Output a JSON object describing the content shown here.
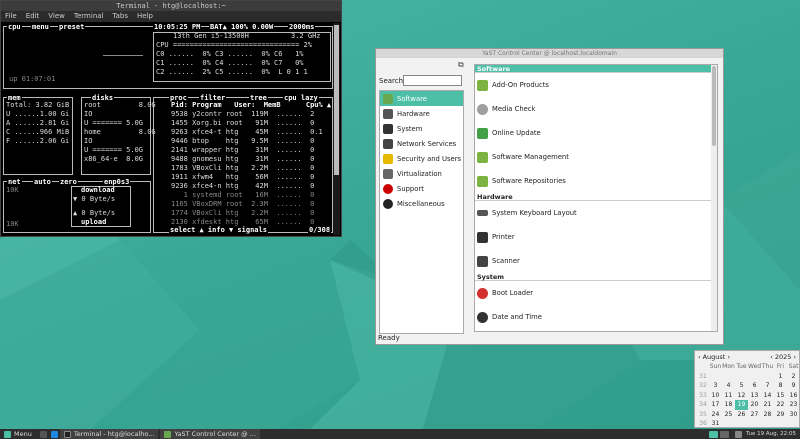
{
  "terminal": {
    "title": "Terminal - htg@localhost:~",
    "menu": [
      "File",
      "Edit",
      "View",
      "Terminal",
      "Tabs",
      "Help"
    ],
    "cpu_box": {
      "label": "cpu",
      "menu": "menu",
      "preset": "preset",
      "clock": "10:05:25 PM",
      "battery": "BAT▲ 100% 0.00W",
      "refresh": "2000ms",
      "model": "13th Gen i5-13500H",
      "freq": "3.2 GHz",
      "rows": [
        "CPU ============================== 2%",
        "C0 ......  0% C3 ......  0% C6   1%",
        "C1 ......  0% C4 ......  0% C7   0%",
        "C2 ......  2% C5 ......  0%  L 0 1 1"
      ],
      "uptime": "up 01:07:01"
    },
    "mem_box": {
      "label": "mem",
      "rows": [
        "Total: 3.82 GiB",
        "U ......1.00 Gi",
        "A ......2.81 Gi",
        "C ......966 MiB",
        "F ......2.06 Gi"
      ]
    },
    "disks_box": {
      "label": "disks",
      "rows": [
        "root         8.0G",
        "IO",
        "U ======= 5.0G",
        "home         8.0G",
        "IO",
        "U ======= 5.0G",
        "x86_64-e  8.0G"
      ]
    },
    "proc_box": {
      "label": "proc",
      "filter": "filter",
      "tree": "tree",
      "sort": "cpu lazy",
      "header": "Pid: Program   User:  MemB      Cpu% ▲",
      "rows": [
        "9538 y2contr root  119M  ......  2",
        "1455 Xorg.bi root   91M  ......  0",
        "9263 xfce4-t htg    45M  ......  0.1",
        "9446 btop    htg   9.5M  ......  0",
        "2141 wrapper htg    31M  ......  0",
        "9488 gnomesu htg    31M  ......  0",
        "1783 VBoxCli htg   2.2M  ......  0",
        "1911 xfwm4   htg    56M  ......  0",
        "9236 xfce4-n htg    42M  ......  0",
        "   1 systemd root   16M  ......  0",
        "1165 VBoxDRM root  2.3M  ......  0",
        "1774 VBoxCli htg   2.2M  ......  0",
        "2130 xfdeskt htg    65M  ......  0"
      ],
      "footer": "select ▲ info ▼ signals",
      "count": "0/308"
    },
    "net_box": {
      "label": "net",
      "auto": "auto",
      "zero": "zero",
      "iface": "enp0s3",
      "y_top": "10K",
      "y_bottom": "10K",
      "download_label": "download",
      "download_value": "▼ 0 Byte/s",
      "upload_value": "▲ 0 Byte/s",
      "upload_label": "upload"
    }
  },
  "yast": {
    "title": "YaST Control Center @ localhost.localdomain",
    "search_label": "Search",
    "categories": [
      {
        "label": "Software",
        "icon": "software-icon",
        "selected": true,
        "color": "#6aa84f"
      },
      {
        "label": "Hardware",
        "icon": "hardware-icon",
        "selected": false,
        "color": "#555555"
      },
      {
        "label": "System",
        "icon": "system-icon",
        "selected": false,
        "color": "#333333"
      },
      {
        "label": "Network Services",
        "icon": "network-services-icon",
        "selected": false,
        "color": "#444444"
      },
      {
        "label": "Security and Users",
        "icon": "security-icon",
        "selected": false,
        "color": "#e6b800"
      },
      {
        "label": "Virtualization",
        "icon": "virtualization-icon",
        "selected": false,
        "color": "#666666"
      },
      {
        "label": "Support",
        "icon": "support-icon",
        "selected": false,
        "color": "#cc0000"
      },
      {
        "label": "Miscellaneous",
        "icon": "miscellaneous-icon",
        "selected": false,
        "color": "#222222"
      }
    ],
    "groups": [
      {
        "label": "Software",
        "selected": true,
        "modules": [
          {
            "label": "Add-On Products",
            "icon": "add-on-products-icon",
            "color": "#7cb342"
          },
          {
            "label": "Media Check",
            "icon": "media-check-icon",
            "color": "#9e9e9e"
          },
          {
            "label": "Online Update",
            "icon": "online-update-icon",
            "color": "#43a047"
          },
          {
            "label": "Software Management",
            "icon": "software-management-icon",
            "color": "#7cb342"
          },
          {
            "label": "Software Repositories",
            "icon": "software-repositories-icon",
            "color": "#7cb342"
          }
        ]
      },
      {
        "label": "Hardware",
        "selected": false,
        "modules": [
          {
            "label": "System Keyboard Layout",
            "icon": "keyboard-icon",
            "color": "#555555"
          },
          {
            "label": "Printer",
            "icon": "printer-icon",
            "color": "#333333"
          },
          {
            "label": "Scanner",
            "icon": "scanner-icon",
            "color": "#444444"
          }
        ]
      },
      {
        "label": "System",
        "selected": false,
        "modules": [
          {
            "label": "Boot Loader",
            "icon": "boot-loader-icon",
            "color": "#d32f2f"
          },
          {
            "label": "Date and Time",
            "icon": "date-time-icon",
            "color": "#333333"
          }
        ]
      }
    ],
    "status": "Ready"
  },
  "calendar": {
    "month": "August",
    "year": "2025",
    "weekday_headers": [
      "Sun",
      "Mon",
      "Tue",
      "Wed",
      "Thu",
      "Fri",
      "Sat"
    ],
    "weeks": [
      {
        "wk": "31",
        "days": [
          "",
          "",
          "",
          "",
          "",
          "1",
          "2"
        ]
      },
      {
        "wk": "32",
        "days": [
          "3",
          "4",
          "5",
          "6",
          "7",
          "8",
          "9"
        ]
      },
      {
        "wk": "33",
        "days": [
          "10",
          "11",
          "12",
          "13",
          "14",
          "15",
          "16"
        ]
      },
      {
        "wk": "34",
        "days": [
          "17",
          "18",
          "19",
          "20",
          "21",
          "22",
          "23"
        ]
      },
      {
        "wk": "35",
        "days": [
          "24",
          "25",
          "26",
          "27",
          "28",
          "29",
          "30"
        ]
      },
      {
        "wk": "36",
        "days": [
          "31",
          "",
          "",
          "",
          "",
          "",
          ""
        ]
      }
    ],
    "today": "19",
    "accent": "#4ebfa7"
  },
  "taskbar": {
    "menu_label": "Menu",
    "windows": [
      {
        "label": "Terminal - htg@localho...",
        "icon": "terminal-icon"
      },
      {
        "label": "YaST Control Center @ ...",
        "icon": "yast-icon"
      }
    ],
    "clock": "Tue 19 Aug, 22:05"
  }
}
